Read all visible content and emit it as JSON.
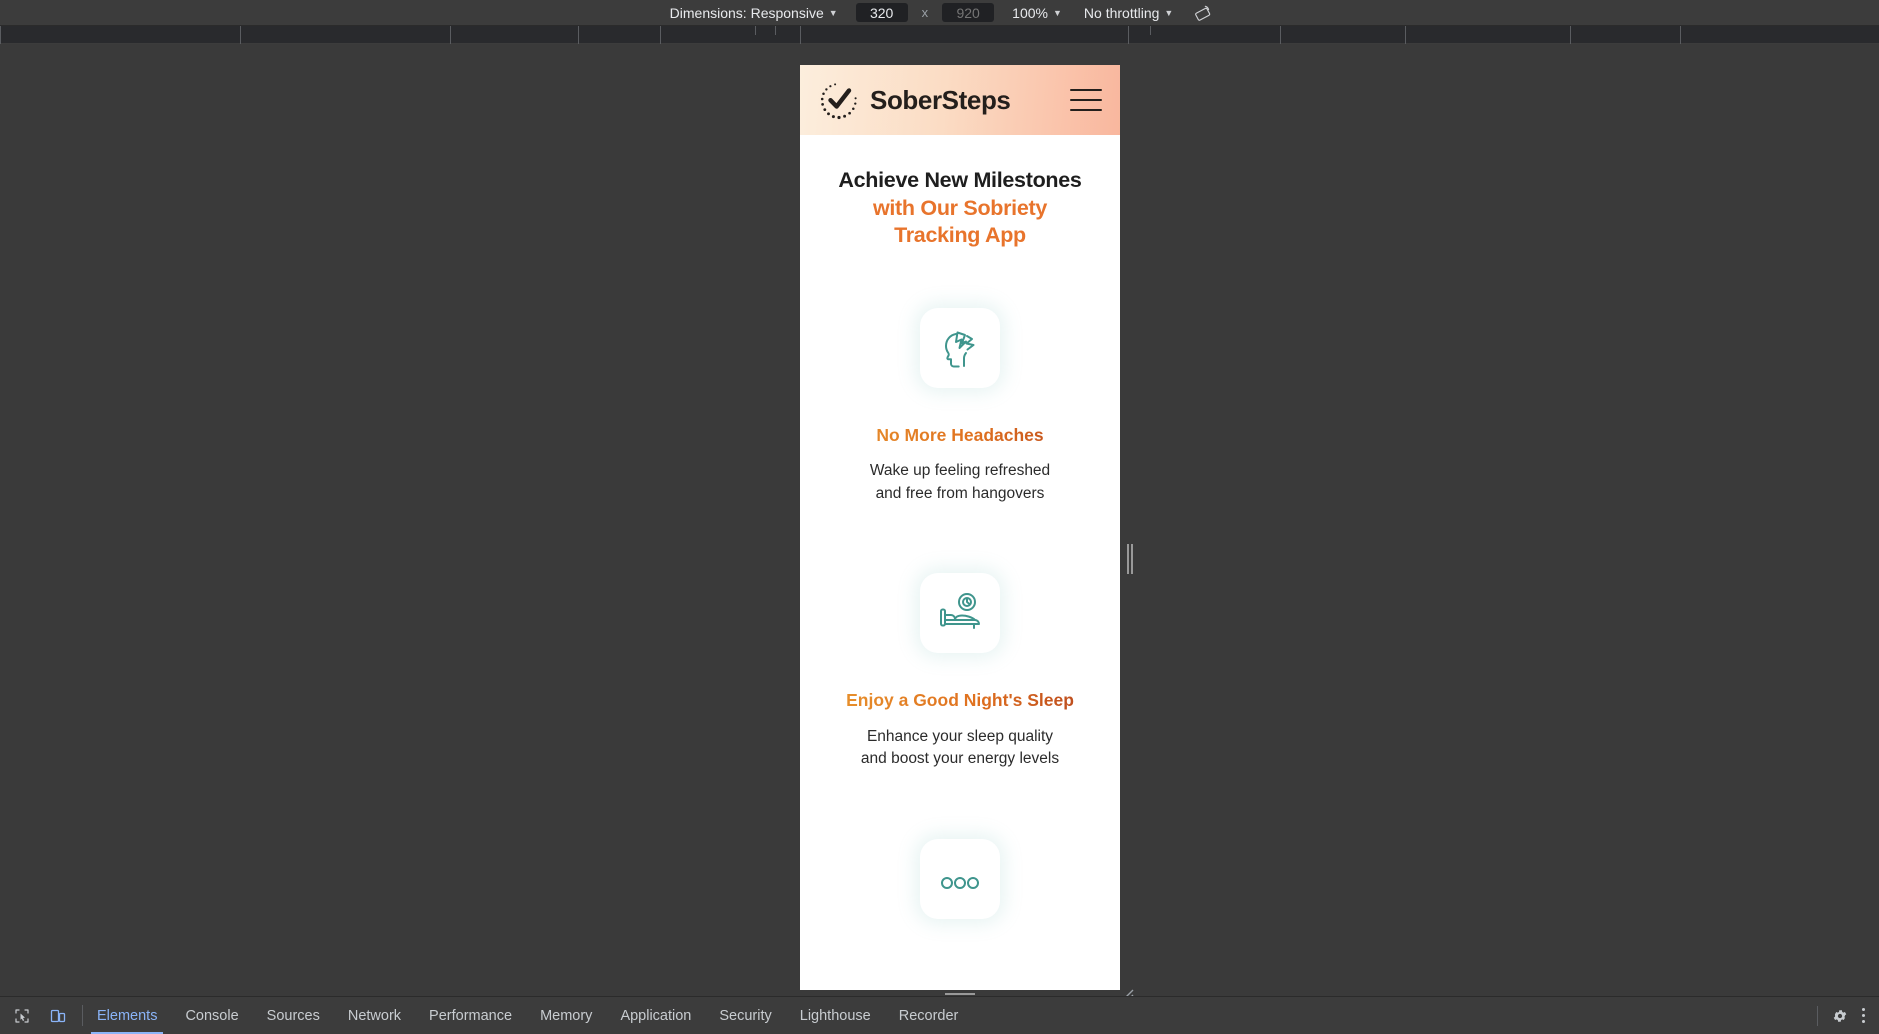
{
  "device_toolbar": {
    "dimensions_label": "Dimensions: Responsive",
    "width_value": "320",
    "height_placeholder": "920",
    "multiply_symbol": "x",
    "zoom_label": "100%",
    "throttling_label": "No throttling",
    "rotate_icon": "rotate-device-icon",
    "caret_icon": "chevron-down-icon"
  },
  "app": {
    "header": {
      "brand": "SoberSteps",
      "logo_icon": "check-circle-dotted-icon",
      "menu_icon": "hamburger-menu-icon",
      "gradient_from": "#fceedd",
      "gradient_to": "#f9b79e"
    },
    "hero": {
      "line1": "Achieve New Milestones",
      "line2": "with Our Sobriety",
      "line3": "Tracking App",
      "accent_color": "#e8742c"
    },
    "features": [
      {
        "icon": "head-lightning-headache-icon",
        "title": "No More Headaches",
        "desc_line1": "Wake up feeling refreshed",
        "desc_line2": "and free from hangovers",
        "icon_color": "#3f958d"
      },
      {
        "icon": "bed-clock-sleep-icon",
        "title": "Enjoy a Good Night's Sleep",
        "desc_line1": "Enhance your sleep quality",
        "desc_line2": "and boost your energy levels",
        "icon_color": "#3f958d"
      },
      {
        "icon": "partial-third-feature-icon",
        "title": "",
        "desc_line1": "",
        "desc_line2": "",
        "icon_color": "#3f958d"
      }
    ]
  },
  "devtools": {
    "inspect_icon": "inspect-element-icon",
    "device_toggle_icon": "device-toolbar-icon",
    "tabs": [
      {
        "label": "Elements",
        "active": true
      },
      {
        "label": "Console",
        "active": false
      },
      {
        "label": "Sources",
        "active": false
      },
      {
        "label": "Network",
        "active": false
      },
      {
        "label": "Performance",
        "active": false
      },
      {
        "label": "Memory",
        "active": false
      },
      {
        "label": "Application",
        "active": false
      },
      {
        "label": "Security",
        "active": false
      },
      {
        "label": "Lighthouse",
        "active": false
      },
      {
        "label": "Recorder",
        "active": false
      }
    ],
    "settings_icon": "gear-icon",
    "more_icon": "kebab-menu-icon",
    "active_color": "#8ab4f8"
  }
}
